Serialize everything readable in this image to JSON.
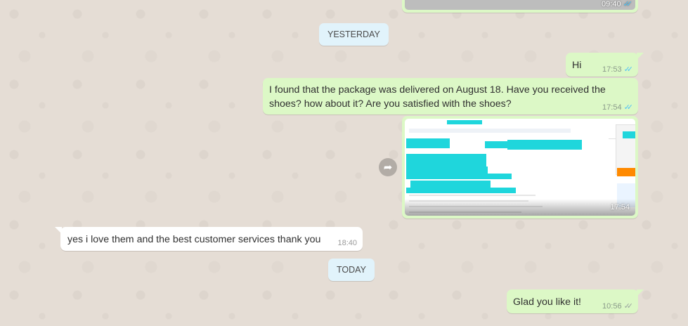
{
  "colors": {
    "outgoing": "#dcf8c6",
    "incoming": "#ffffff",
    "date_chip": "#e1f3fb",
    "read_ticks": "#4fc3f7",
    "redaction": "#1fd6dc"
  },
  "top_partial": {
    "time": "09:40",
    "status_icon": "double-check-icon"
  },
  "dividers": {
    "yesterday": "YESTERDAY",
    "today": "TODAY"
  },
  "messages": [
    {
      "direction": "out",
      "text": "Hi",
      "time": "17:53",
      "status_icon": "double-check-icon"
    },
    {
      "direction": "out",
      "text": "I found that the package was delivered on August 18. Have you received the shoes? how about it? Are you satisfied with the shoes?",
      "time": "17:54",
      "status_icon": "double-check-icon"
    },
    {
      "direction": "out",
      "type": "image",
      "time": "17:54",
      "forward_icon": "forward-arrow-icon"
    },
    {
      "direction": "in",
      "text": "yes i love them and the best customer services thank you",
      "time": "18:40"
    },
    {
      "direction": "out",
      "text": "Glad you like it!",
      "time": "10:56",
      "status_icon": "double-check-icon"
    }
  ]
}
